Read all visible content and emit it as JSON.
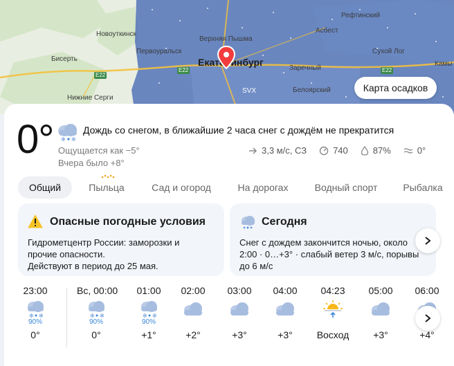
{
  "map": {
    "labels": {
      "novotkinsk": "Новоуткинск",
      "pervouralsk": "Первоуральск",
      "verkhnyaya_pyshma": "Верхняя Пышма",
      "refty": "Рефтинский",
      "asbest": "Асбест",
      "sukhoi_log": "Сухой Лог",
      "kamyshlov": "Камы",
      "bisert": "Бисерть",
      "ekaterinburg": "Екатеринбург",
      "zarechny": "Заречный",
      "beloyarsky": "Белоярский",
      "nizhnie_sergi": "Нижние Серги",
      "svx": "SVX",
      "e22_a": "E22",
      "e22_b": "E22",
      "e22_c": "E22"
    },
    "precip_button": "Карта осадков",
    "colors": {
      "precip": "#4f73b8",
      "land": "#e9eee2",
      "forest": "#cfe3c1",
      "road": "#f4c842"
    }
  },
  "current": {
    "temp": "0°",
    "headline": "Дождь со снегом, в ближайшие 2 часа снег с дождём не прекратится",
    "feels_like": "Ощущается как −5°",
    "yesterday": "Вчера было +8°",
    "wind": "3,3 м/с, СЗ",
    "pressure": "740",
    "humidity": "87%",
    "water_temp": "0°"
  },
  "tabs": [
    "Общий",
    "Пыльца",
    "Сад и огород",
    "На дорогах",
    "Водный спорт",
    "Рыбалка"
  ],
  "info_cards": {
    "danger": {
      "title": "Опасные погодные условия",
      "line1": "Гидрометцентр России: заморозки и",
      "line2": "прочие опасности.",
      "line3": "Действуют в период до 25 мая."
    },
    "today": {
      "title": "Сегодня",
      "line1": "Снег с дождем закончится ночью, около",
      "line2": "2:00 · 0…+3° · слабый ветер 3 м/с, порывы",
      "line3": "до 6 м/с"
    }
  },
  "hourly": [
    {
      "time": "23:00",
      "icon": "sleet-icon",
      "precip": "90%",
      "temp": "0°"
    },
    {
      "time": "Вс, 00:00",
      "icon": "sleet-icon",
      "precip": "90%",
      "temp": "0°"
    },
    {
      "time": "01:00",
      "icon": "sleet-icon",
      "precip": "90%",
      "temp": "+1°"
    },
    {
      "time": "02:00",
      "icon": "cloud-icon",
      "precip": "",
      "temp": "+2°"
    },
    {
      "time": "03:00",
      "icon": "cloud-icon",
      "precip": "",
      "temp": "+3°"
    },
    {
      "time": "04:00",
      "icon": "cloud-icon",
      "precip": "",
      "temp": "+3°"
    },
    {
      "time": "04:23",
      "icon": "sunrise-icon",
      "precip": "",
      "temp": "Восход"
    },
    {
      "time": "05:00",
      "icon": "cloud-icon",
      "precip": "",
      "temp": "+3°"
    },
    {
      "time": "06:00",
      "icon": "cloud-icon",
      "precip": "",
      "temp": "+4°"
    }
  ]
}
